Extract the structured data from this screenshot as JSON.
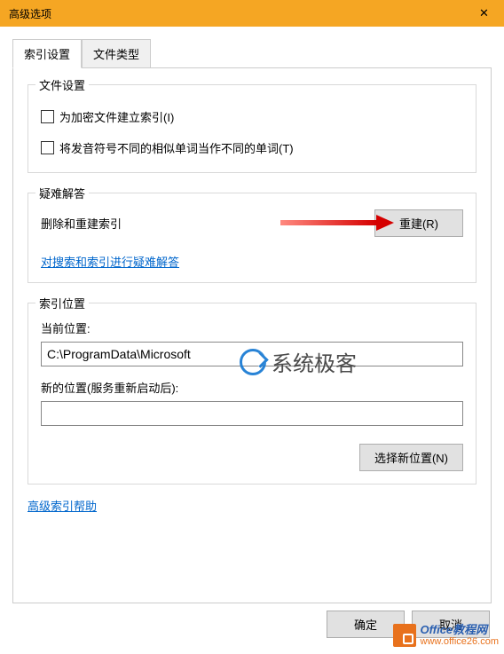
{
  "titlebar": {
    "title": "高级选项",
    "close": "✕"
  },
  "tabs": [
    {
      "label": "索引设置",
      "active": true
    },
    {
      "label": "文件类型",
      "active": false
    }
  ],
  "file_settings": {
    "title": "文件设置",
    "index_encrypted": "为加密文件建立索引(I)",
    "diacritics": "将发音符号不同的相似单词当作不同的单词(T)"
  },
  "troubleshoot": {
    "title": "疑难解答",
    "delete_rebuild_label": "删除和重建索引",
    "rebuild_button": "重建(R)",
    "search_index_link": "对搜索和索引进行疑难解答"
  },
  "index_location": {
    "title": "索引位置",
    "current_label": "当前位置:",
    "current_value": "C:\\ProgramData\\Microsoft",
    "new_label": "新的位置(服务重新启动后):",
    "new_value": "",
    "choose_button": "选择新位置(N)"
  },
  "links": {
    "advanced_help": "高级索引帮助"
  },
  "buttons": {
    "ok": "确定",
    "cancel": "取消"
  },
  "watermark1": "系统极客",
  "watermark2": {
    "line1": "Office教程网",
    "line2": "www.office26.com"
  }
}
